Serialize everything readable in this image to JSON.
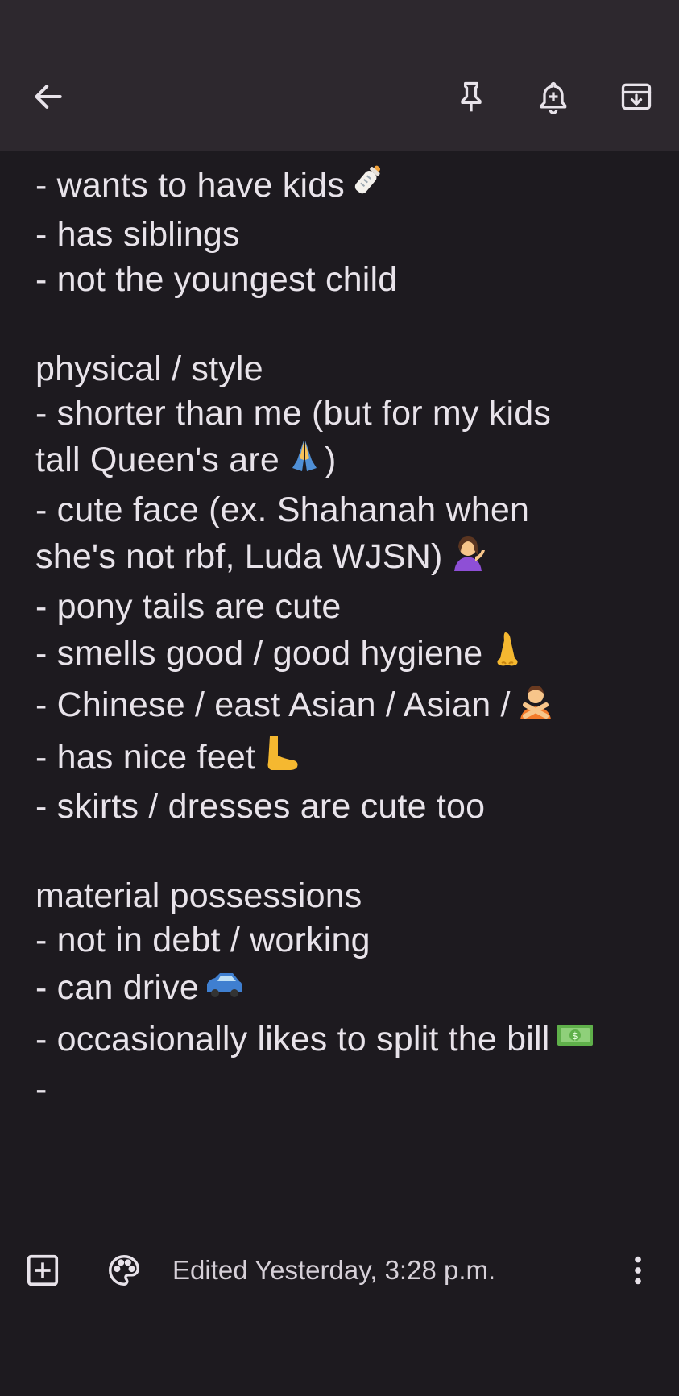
{
  "header": {
    "back_icon": "arrow-left-icon",
    "pin_icon": "pin-icon",
    "reminder_icon": "add-reminder-bell-icon",
    "archive_icon": "archive-icon"
  },
  "note": {
    "lines": [
      "- wants to have kids",
      "- has siblings",
      "- not the youngest child",
      "",
      "physical / style",
      "- shorter than me (but for my kids",
      "tall Queen's are",
      ")",
      "- cute face (ex. Shahanah when",
      "she's not rbf, Luda WJSN)",
      "- pony tails are cute",
      "- smells good / good hygiene",
      "- Chinese / east Asian / Asian /",
      "- has nice feet",
      "- skirts / dresses are cute too",
      "",
      "material possessions",
      "- not in debt / working",
      "- can drive",
      "- occasionally likes to split the bill",
      "-"
    ],
    "emojis": {
      "baby_bottle": "baby-bottle-emoji",
      "folded_hands": "folded-hands-emoji",
      "tipping_hand": "person-tipping-hand-emoji",
      "nose": "nose-emoji",
      "no_gesture": "person-gesturing-no-emoji",
      "foot": "foot-emoji",
      "car": "car-emoji",
      "money": "dollar-banknote-emoji"
    }
  },
  "footer": {
    "add_icon": "add-box-icon",
    "palette_icon": "palette-icon",
    "edited_text": "Edited Yesterday, 3:28 p.m.",
    "more_icon": "more-vert-icon"
  },
  "colors": {
    "background": "#1d1a1f",
    "topbar": "#2d282e",
    "text": "#e8e3ea"
  }
}
